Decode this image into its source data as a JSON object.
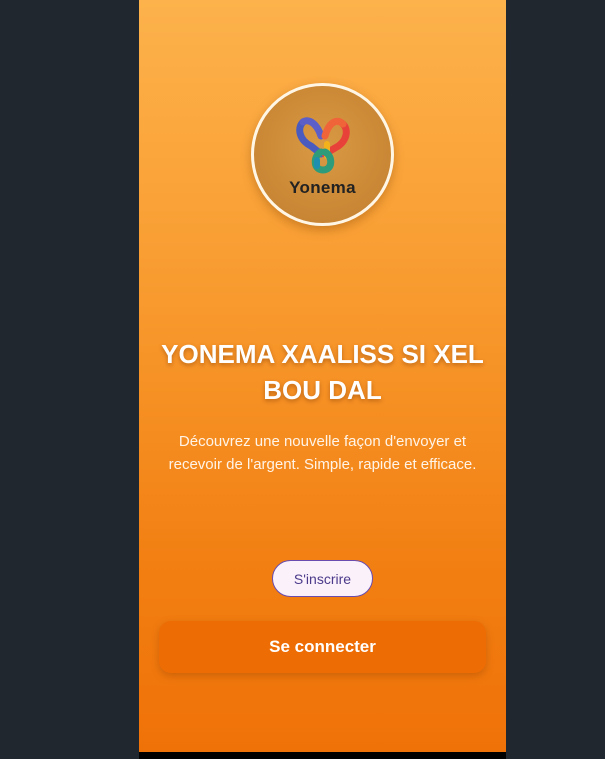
{
  "brand": {
    "logo_text": "Yonema",
    "colors": {
      "blue": "#4a5bbf",
      "red": "#e8413a",
      "yellow": "#f3b21b",
      "green": "#2e9c7a",
      "teal": "#1f8fb0"
    }
  },
  "hero": {
    "headline": "YONEMA XAALISS SI XEL BOU DAL",
    "subtitle": "Découvrez une nouvelle façon d'envoyer et recevoir de l'argent. Simple, rapide et efficace."
  },
  "actions": {
    "signup_label": "S'inscrire",
    "login_label": "Se connecter"
  },
  "theme": {
    "accent": "#ef7208",
    "background": "#20272e"
  }
}
